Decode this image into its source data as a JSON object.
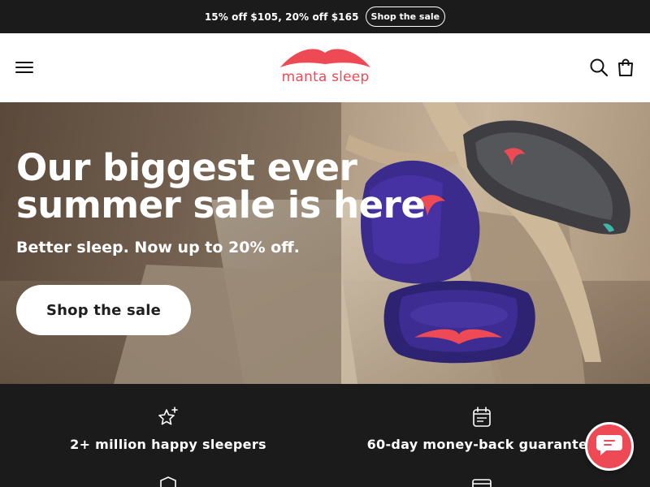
{
  "announcement": {
    "text": "15% off $105, 20% off $165",
    "button_label": "Shop the sale"
  },
  "header": {
    "logo_text": "manta sleep",
    "icons": [
      "menu-icon",
      "search-icon",
      "cart-icon"
    ]
  },
  "hero": {
    "title": "Our biggest ever summer sale is here",
    "subtitle": "Better sleep. Now up to 20% off.",
    "cta_label": "Shop the sale"
  },
  "features": [
    {
      "icon": "sparkle-star-icon",
      "label": "2+ million happy sleepers"
    },
    {
      "icon": "calendar-icon",
      "label": "60-day money-back guarantee"
    },
    {
      "icon": "shield-check-icon",
      "label": ""
    },
    {
      "icon": "credit-card-icon",
      "label": ""
    }
  ],
  "chat": {
    "icon": "chat-icon"
  },
  "colors": {
    "brand": "#ee4a55",
    "dark": "#1b1b1b",
    "mask_blue": "#3a2a86"
  }
}
